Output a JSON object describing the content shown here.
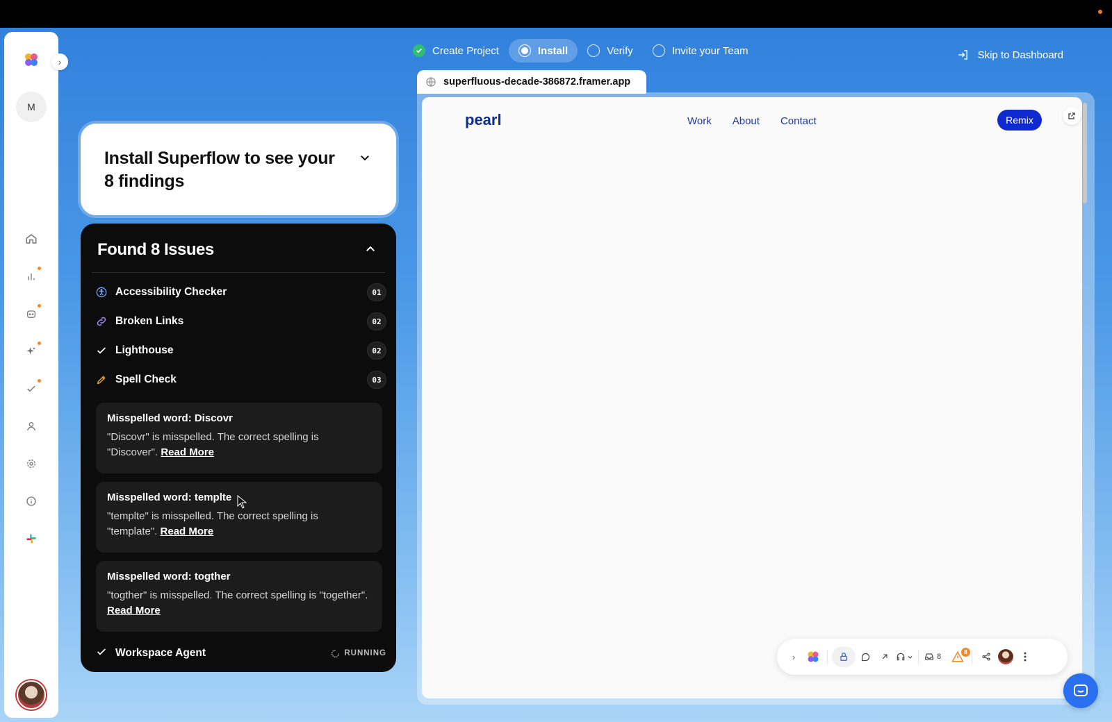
{
  "stepper": {
    "steps": [
      {
        "label": "Create Project",
        "state": "done"
      },
      {
        "label": "Install",
        "state": "current"
      },
      {
        "label": "Verify",
        "state": "pending"
      },
      {
        "label": "Invite your Team",
        "state": "pending"
      }
    ],
    "skip_label": "Skip to Dashboard"
  },
  "sidebar": {
    "avatar_initial": "M",
    "icons": [
      "home-icon",
      "chart-icon",
      "bot-icon",
      "sparkle-icon",
      "check-icon",
      "user-icon",
      "gear-icon",
      "info-icon",
      "slack-icon"
    ]
  },
  "install_card": {
    "title": "Install Superflow to see your 8 findings"
  },
  "issues": {
    "title": "Found 8 Issues",
    "items": [
      {
        "label": "Accessibility Checker",
        "count": "01",
        "icon": "accessibility-icon",
        "color": "#6ea8ff"
      },
      {
        "label": "Broken Links",
        "count": "02",
        "icon": "link-icon",
        "color": "#a98bff"
      },
      {
        "label": "Lighthouse",
        "count": "02",
        "icon": "check-icon",
        "color": "#ffffff"
      },
      {
        "label": "Spell Check",
        "count": "03",
        "icon": "pencil-icon",
        "color": "#f0b429"
      }
    ],
    "findings": [
      {
        "title": "Misspelled word: Discovr",
        "desc": "\"Discovr\" is misspelled. The correct spelling is \"Discover\".",
        "link": "Read More"
      },
      {
        "title": "Misspelled word: templte",
        "desc": "\"templte\" is misspelled. The correct spelling is \"template\".",
        "link": "Read More"
      },
      {
        "title": "Misspelled word: togther",
        "desc": "\"togther\" is misspelled. The correct spelling is \"together\".",
        "link": "Read More"
      }
    ],
    "agent": {
      "label": "Workspace Agent",
      "status": "RUNNING"
    }
  },
  "browser": {
    "url": "superfluous-decade-386872.framer.app",
    "site": {
      "brand": "pearl",
      "nav": [
        "Work",
        "About",
        "Contact"
      ],
      "cta": "Remix"
    }
  },
  "toolbar": {
    "inbox_count": "8",
    "warning_count": "8"
  },
  "colors": {
    "accent_blue": "#0f2bd0",
    "done_green": "#2fbf71",
    "badge_orange": "#f08a2c"
  }
}
